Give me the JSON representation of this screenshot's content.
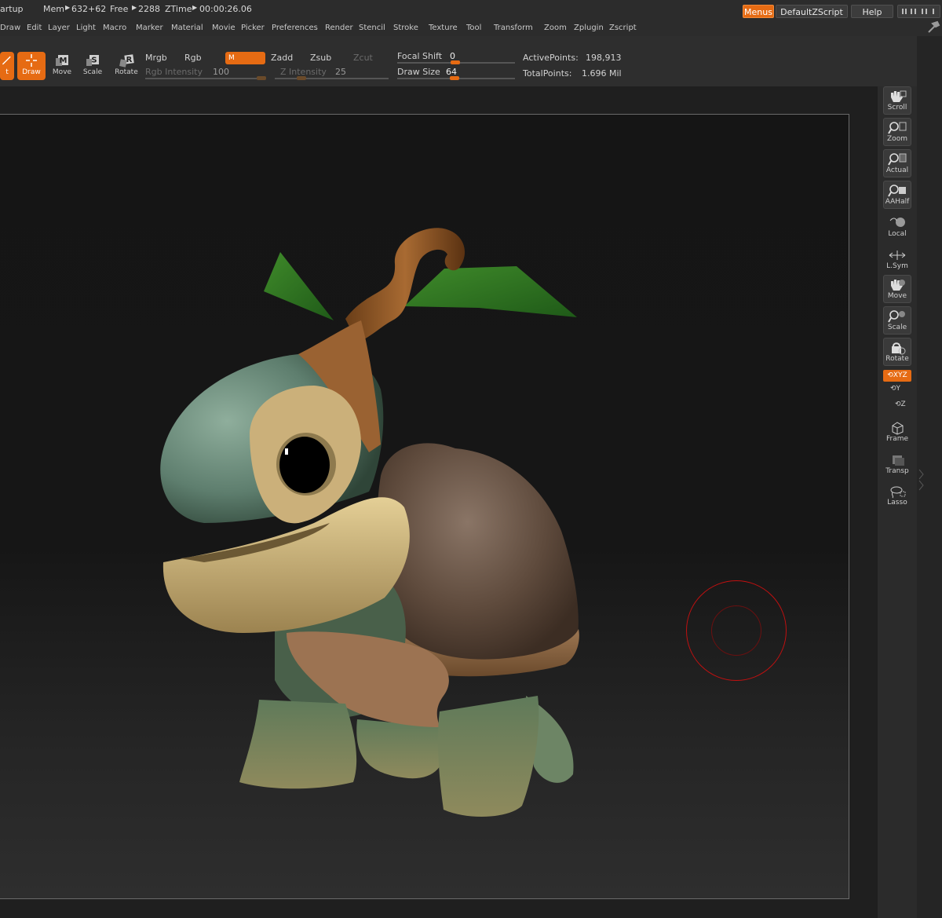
{
  "status": {
    "startup": "artup",
    "mem_label": "Mem",
    "mem_value": "632+62",
    "free_label": "Free",
    "free_value": "2288",
    "ztime_label": "ZTime",
    "ztime_value": "00:00:26.06"
  },
  "header_buttons": {
    "menus": "Menus",
    "script": "DefaultZScript",
    "help": "Help"
  },
  "menu_items": [
    "Draw",
    "Edit",
    "Layer",
    "Light",
    "Macro",
    "Marker",
    "Material",
    "Movie",
    "Picker",
    "Preferences",
    "Render",
    "Stencil",
    "Stroke",
    "Texture",
    "Tool",
    "Transform",
    "Zoom",
    "Zplugin",
    "Zscript"
  ],
  "toolbar": {
    "edit_label": "t",
    "draw_label": "Draw",
    "move_label": "Move",
    "scale_label": "Scale",
    "rotate_label": "Rotate",
    "mrgb": "Mrgb",
    "rgb": "Rgb",
    "m": "M",
    "zadd": "Zadd",
    "zsub": "Zsub",
    "zcut": "Zcut",
    "rgb_intensity_label": "Rgb Intensity",
    "rgb_intensity_value": "100",
    "z_intensity_label": "Z Intensity",
    "z_intensity_value": "25",
    "focal_shift_label": "Focal Shift",
    "focal_shift_value": "0",
    "draw_size_label": "Draw Size",
    "draw_size_value": "64",
    "active_points_label": "ActivePoints:",
    "active_points_value": "198,913",
    "total_points_label": "TotalPoints:",
    "total_points_value": "1.696 Mil"
  },
  "shelf": {
    "scroll": "Scroll",
    "zoom": "Zoom",
    "actual": "Actual",
    "aahalf": "AAHalf",
    "local": "Local",
    "lsym": "L.Sym",
    "move": "Move",
    "scale": "Scale",
    "rotate": "Rotate",
    "xyz": "XYZ",
    "y": "Y",
    "z": "Z",
    "frame": "Frame",
    "transp": "Transp",
    "lasso": "Lasso"
  },
  "colors": {
    "accent": "#e66b13",
    "brush_cursor": "#c01010"
  }
}
